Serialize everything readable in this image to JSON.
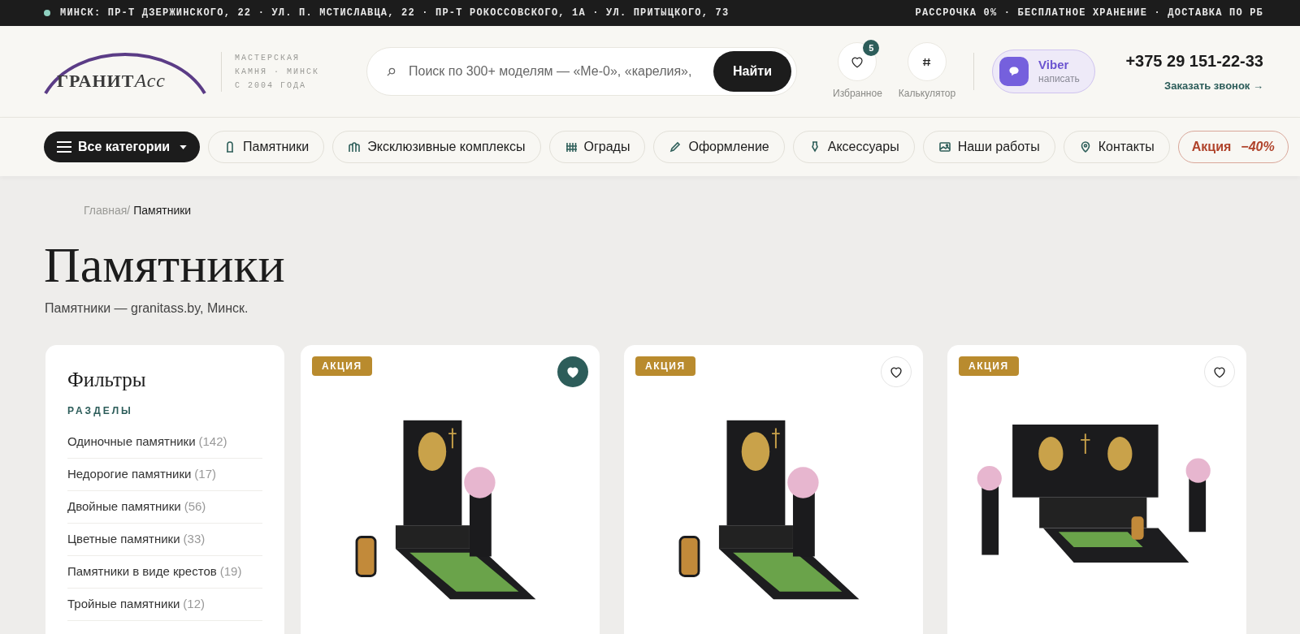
{
  "top_bar": {
    "addresses": "МИНСК: ПР-Т ДЗЕРЖИНСКОГО, 22 · УЛ. П. МСТИСЛАВЦА, 22 · ПР-Т РОКОССОВСКОГО, 1А · УЛ. ПРИТЫЦКОГО, 73",
    "perks": "РАССРОЧКА 0% · БЕСПЛАТНОЕ ХРАНЕНИЕ · ДОСТАВКА ПО РБ"
  },
  "header": {
    "logo": {
      "main": "ГРАНИТ",
      "script": "Асс"
    },
    "tagline": [
      "МАСТЕРСКАЯ",
      "КАМНЯ · МИНСК",
      "С 2004 ГОДА"
    ],
    "search": {
      "placeholder": "Поиск по 300+ моделям — «Ме-0», «карелия»,",
      "button": "Найти"
    },
    "favorites": {
      "label": "Избранное",
      "count": "5"
    },
    "calculator": {
      "label": "Калькулятор"
    },
    "viber": {
      "title": "Viber",
      "subtitle": "написать"
    },
    "phone": "+375 29 151-22-33",
    "callback": "Заказать звонок →"
  },
  "nav": [
    {
      "kind": "menu",
      "label": "Все категории"
    },
    {
      "kind": "link",
      "label": "Памятники"
    },
    {
      "kind": "link",
      "label": "Эксклюзивные комплексы"
    },
    {
      "kind": "link",
      "label": "Ограды"
    },
    {
      "kind": "link",
      "label": "Оформление"
    },
    {
      "kind": "link",
      "label": "Аксессуары"
    },
    {
      "kind": "link",
      "label": "Наши работы"
    },
    {
      "kind": "link",
      "label": "Контакты"
    },
    {
      "kind": "sale",
      "label": "Акция",
      "discount": "−40%"
    }
  ],
  "breadcrumb": {
    "home": "Главная/",
    "current": "Памятники"
  },
  "page": {
    "title": "Памятники",
    "subtitle": "Памятники — granitass.by, Минск."
  },
  "filters": {
    "title": "Фильтры",
    "section": "РАЗДЕЛЫ",
    "items": [
      {
        "label": "Одиночные памятники",
        "count": "(142)"
      },
      {
        "label": "Недорогие памятники",
        "count": "(17)"
      },
      {
        "label": "Двойные памятники",
        "count": "(56)"
      },
      {
        "label": "Цветные памятники",
        "count": "(33)"
      },
      {
        "label": "Памятники в виде крестов",
        "count": "(19)"
      },
      {
        "label": "Тройные памятники",
        "count": "(12)"
      }
    ]
  },
  "products": [
    {
      "badge": "АКЦИЯ",
      "favorite": true,
      "kind": "single"
    },
    {
      "badge": "АКЦИЯ",
      "favorite": false,
      "kind": "single"
    },
    {
      "badge": "АКЦИЯ",
      "favorite": false,
      "kind": "double"
    }
  ]
}
